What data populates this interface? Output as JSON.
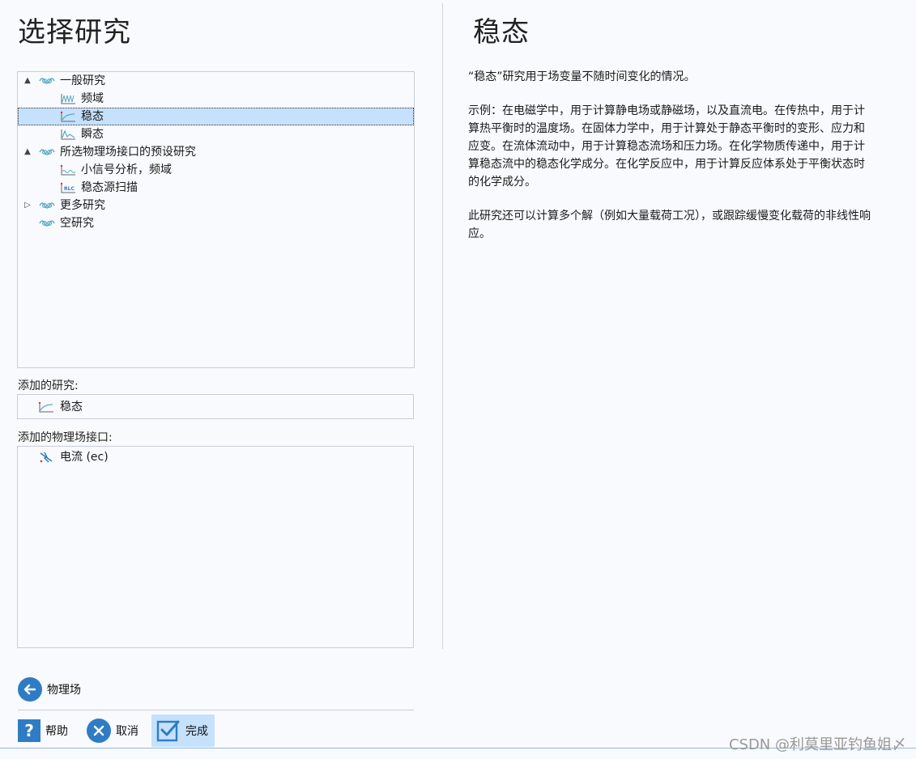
{
  "left": {
    "title": "选择研究",
    "tree": [
      {
        "label": "一般研究",
        "level": 0,
        "expander": "▲",
        "icon": "study-group-icon"
      },
      {
        "label": "频域",
        "level": 1,
        "icon": "frequency-domain-icon"
      },
      {
        "label": "稳态",
        "level": 1,
        "icon": "stationary-icon",
        "selected": true
      },
      {
        "label": "瞬态",
        "level": 1,
        "icon": "time-dependent-icon"
      },
      {
        "label": "所选物理场接口的预设研究",
        "level": 0,
        "expander": "▲",
        "icon": "study-group-icon"
      },
      {
        "label": "小信号分析，频域",
        "level": 1,
        "icon": "small-signal-icon"
      },
      {
        "label": "稳态源扫描",
        "level": 1,
        "icon": "source-sweep-icon"
      },
      {
        "label": "更多研究",
        "level": 0,
        "expander": "▷",
        "icon": "study-group-icon"
      },
      {
        "label": "空研究",
        "level": 0,
        "icon": "study-group-icon"
      }
    ],
    "added_studies_label": "添加的研究:",
    "added_studies": [
      "稳态"
    ],
    "added_physics_label": "添加的物理场接口:",
    "added_physics": [
      "电流 (ec)"
    ]
  },
  "right": {
    "title": "稳态",
    "paragraphs": [
      "“稳态”研究用于场变量不随时间变化的情况。",
      "示例：在电磁学中，用于计算静电场或静磁场，以及直流电。在传热中，用于计算热平衡时的温度场。在固体力学中，用于计算处于静态平衡时的变形、应力和应变。在流体流动中，用于计算稳态流场和压力场。在化学物质传递中，用于计算稳态流中的稳态化学成分。在化学反应中，用于计算反应体系处于平衡状态时的化学成分。",
      "此研究还可以计算多个解（例如大量载荷工况），或跟踪缓慢变化载荷的非线性响应。"
    ]
  },
  "buttons": {
    "physics": "物理场",
    "help": "帮助",
    "cancel": "取消",
    "done": "完成"
  },
  "watermark": "CSDN @利莫里亚钓鱼姐〆",
  "colors": {
    "accent": "#2f7cc4",
    "selection": "#c5e1fb",
    "icon": "#5aa9c9"
  }
}
